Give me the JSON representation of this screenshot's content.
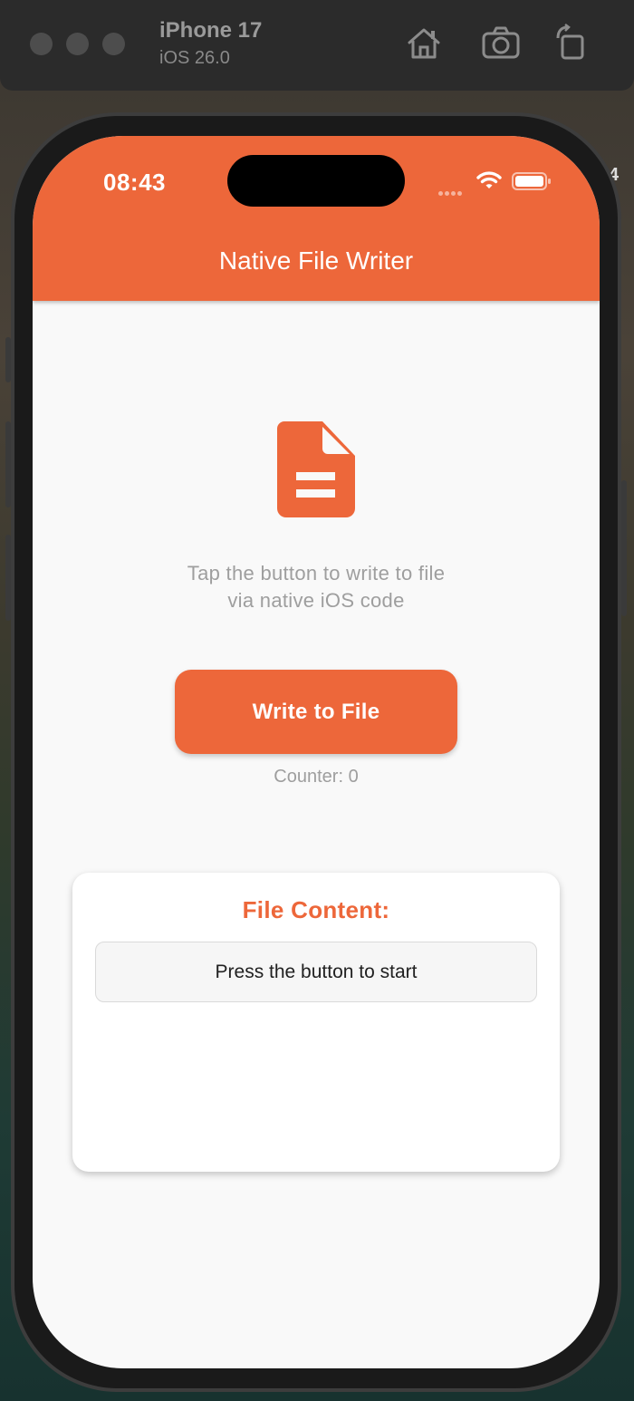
{
  "simulator": {
    "device_name": "iPhone 17",
    "os_version": "iOS 26.0",
    "toolbar_icons": [
      "home-icon",
      "screenshot-icon",
      "rotate-icon"
    ]
  },
  "status_bar": {
    "time": "08:43",
    "icons": [
      "cellular-dots-icon",
      "wifi-icon",
      "battery-icon"
    ]
  },
  "app_bar": {
    "title": "Native File Writer",
    "color": "#ed673a"
  },
  "main": {
    "icon": "document-icon",
    "description_line1": "Tap the button to write to file",
    "description_line2": "via native iOS code",
    "button_label": "Write to File",
    "counter": "Counter: 0"
  },
  "file_card": {
    "title": "File Content:",
    "content": "Press the button to start"
  },
  "background_edge_text": "4",
  "colors": {
    "accent": "#ed673a",
    "screen_bg": "#f9f9f9",
    "muted_text": "#9e9e9e"
  }
}
